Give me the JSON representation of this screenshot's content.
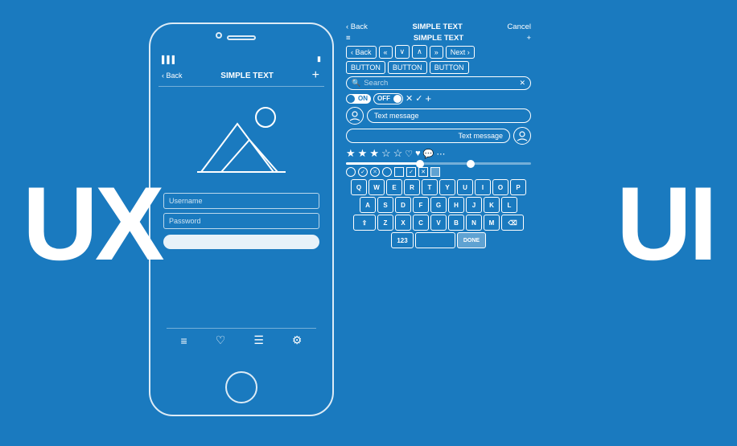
{
  "background_color": "#1a7abf",
  "ux_label": "UX",
  "ui_label": "UI",
  "phone": {
    "status_signal": "▌▌▌",
    "status_battery": "▮",
    "nav_back": "‹ Back",
    "nav_title": "SIMPLE TEXT",
    "nav_plus": "+",
    "image_placeholder": "mountain-image",
    "username_placeholder": "Username",
    "password_placeholder": "Password"
  },
  "ui_kit": {
    "header_back": "‹ Back",
    "header_title": "SIMPLE TEXT",
    "header_cancel": "Cancel",
    "title_row_icon": "≡",
    "title_row_text": "SIMPLE TEXT",
    "title_row_plus": "+",
    "nav_back": "‹ Back",
    "nav_prev_prev": "«",
    "nav_prev": "˅",
    "nav_up": "˄",
    "nav_next": "»",
    "nav_next_label": "Next",
    "btn1": "BUTTON",
    "btn2": "BUTTON",
    "btn3": "BUTTON",
    "search_placeholder": "Search",
    "toggle_on": "ON",
    "toggle_off": "OFF",
    "chat_bubble1": "Text message",
    "chat_bubble2": "Text message",
    "rating_filled": 3,
    "rating_empty": 2,
    "keyboard_rows": [
      [
        "Q",
        "W",
        "E",
        "R",
        "T",
        "Y",
        "U",
        "I",
        "O",
        "P"
      ],
      [
        "A",
        "S",
        "D",
        "F",
        "G",
        "H",
        "J",
        "K",
        "L"
      ],
      [
        "⇧",
        "Z",
        "X",
        "C",
        "V",
        "B",
        "N",
        "M",
        "⌫"
      ],
      [
        "123",
        " ",
        "DONE"
      ]
    ],
    "bottom_icons": [
      "≡",
      "♡",
      "☰",
      "⚙"
    ],
    "done_label": "DONE"
  }
}
